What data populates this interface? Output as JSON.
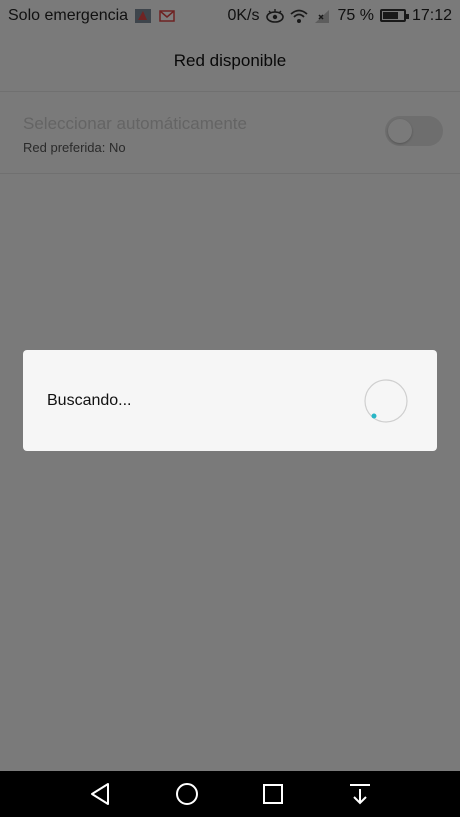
{
  "status_bar": {
    "carrier": "Solo emergencia",
    "speed": "0K/s",
    "battery": "75 %",
    "battery_level": 0.75,
    "time": "17:12",
    "icons": [
      "sim-app-icon",
      "gmail-icon",
      "eye-comfort-icon",
      "wifi-icon",
      "signal-icon",
      "battery-icon"
    ]
  },
  "header": {
    "title": "Red disponible"
  },
  "setting": {
    "title": "Seleccionar automáticamente",
    "subtitle": "Red preferida: No",
    "toggle_on": false
  },
  "dialog": {
    "message": "Buscando..."
  },
  "nav": {
    "icons": [
      "back-icon",
      "home-icon",
      "recents-icon",
      "notifications-pulldown-icon"
    ]
  },
  "colors": {
    "accent": "#29b6c6",
    "overlay": "rgba(0,0,0,0.5)"
  }
}
